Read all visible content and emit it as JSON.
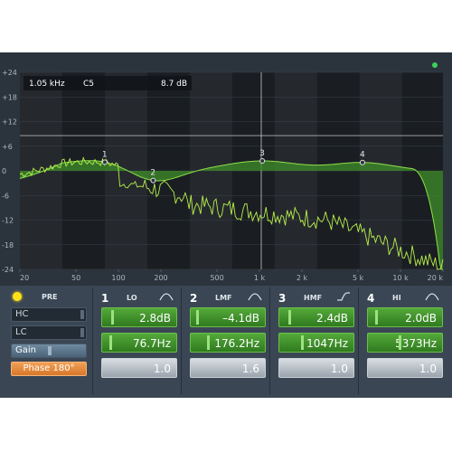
{
  "readout": {
    "freq": "1.05 kHz",
    "note": "C5",
    "gain": "8.7 dB"
  },
  "y_ticks": [
    "+24",
    "+18",
    "+12",
    "+6",
    "0",
    "-6",
    "-12",
    "-18",
    "-24"
  ],
  "x_ticks": [
    "20",
    "50",
    "100",
    "200",
    "500",
    "1 k",
    "2 k",
    "5 k",
    "10 k",
    "20 k"
  ],
  "nodes": [
    {
      "label": "1",
      "freq": 80,
      "gain": 2.8
    },
    {
      "label": "2",
      "freq": 176.2,
      "gain": -4.1
    },
    {
      "label": "3",
      "freq": 1047,
      "gain": 2.4
    },
    {
      "label": "4",
      "freq": 5373,
      "gain": 2.0
    }
  ],
  "pre": {
    "title": "PRE",
    "hc": "HC",
    "lc": "LC",
    "gain": "Gain",
    "phase": "Phase 180°"
  },
  "bands": [
    {
      "num": "1",
      "name": "LO",
      "gain": "2.8dB",
      "freq": "76.7Hz",
      "q": "1.0"
    },
    {
      "num": "2",
      "name": "LMF",
      "gain": "–4.1dB",
      "freq": "176.2Hz",
      "q": "1.6"
    },
    {
      "num": "3",
      "name": "HMF",
      "gain": "2.4dB",
      "freq": "1047Hz",
      "q": "1.0"
    },
    {
      "num": "4",
      "name": "HI",
      "gain": "2.0dB",
      "freq": "5373Hz",
      "q": "1.0"
    }
  ],
  "colors": {
    "accent": "#7ddc2e",
    "knob_green": "#3f8f2a",
    "phase": "#e88a3c",
    "led": "#ffe21a",
    "bg": "#2d3640"
  }
}
